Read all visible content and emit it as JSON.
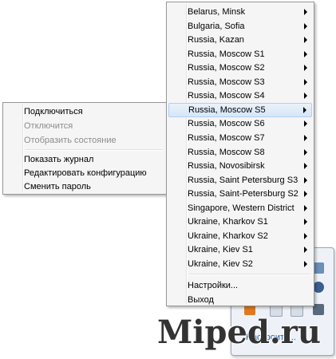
{
  "servers_menu": {
    "items": [
      {
        "label": "Belarus, Minsk"
      },
      {
        "label": "Bulgaria, Sofia"
      },
      {
        "label": "Russia, Kazan"
      },
      {
        "label": "Russia, Moscow S1"
      },
      {
        "label": "Russia, Moscow S2"
      },
      {
        "label": "Russia, Moscow S3"
      },
      {
        "label": "Russia, Moscow S4"
      },
      {
        "label": "Russia, Moscow S5"
      },
      {
        "label": "Russia, Moscow S6"
      },
      {
        "label": "Russia, Moscow S7"
      },
      {
        "label": "Russia, Moscow S8"
      },
      {
        "label": "Russia, Novosibirsk"
      },
      {
        "label": "Russia, Saint Petersburg S3"
      },
      {
        "label": "Russia, Saint-Petersburg S2"
      },
      {
        "label": "Singapore, Western District"
      },
      {
        "label": "Ukraine, Kharkov S1"
      },
      {
        "label": "Ukraine, Kharkov S2"
      },
      {
        "label": "Ukraine, Kiev S1"
      },
      {
        "label": "Ukraine, Kiev S2"
      }
    ],
    "settings_label": "Настройки...",
    "exit_label": "Выход"
  },
  "connection_menu": {
    "connect_label": "Подключиться",
    "disconnect_label": "Отключится",
    "show_status_label": "Отобразить состояние",
    "show_log_label": "Показать журнал",
    "edit_config_label": "Редактировать конфигурацию",
    "change_password_label": "Сменить пароль"
  },
  "tray": {
    "link_label": "Настроить..."
  },
  "watermark": "Miped.ru"
}
